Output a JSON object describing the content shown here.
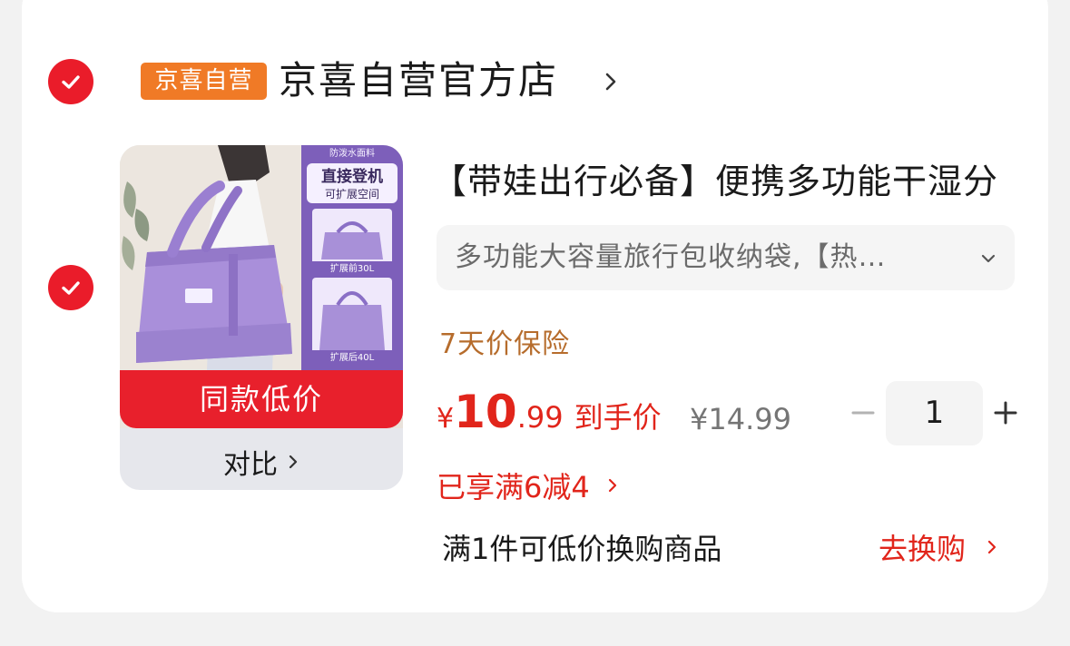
{
  "shop": {
    "badge": "京喜自营",
    "name": "京喜自营官方店"
  },
  "product": {
    "title": "【带娃出行必备】便携多功能干湿分",
    "spec": "多功能大容量旅行包收纳袋,【热…",
    "insurance": "7天价保险",
    "price_currency": "¥",
    "price_integer": "10",
    "price_decimal": ".99",
    "price_label": "到手价",
    "original_price": "¥14.99",
    "quantity": "1",
    "promo": "已享满6减4",
    "exchange_text": "满1件可低价换购商品",
    "exchange_link": "去换购",
    "thumb_banner": "同款低价",
    "compare_label": "对比",
    "thumb_labels": {
      "top": "防泼水面料",
      "headline": "直接登机",
      "sub": "可扩展空间",
      "size1": "扩展前30L",
      "size2": "扩展后40L"
    }
  },
  "colors": {
    "accent_red": "#e1251b",
    "badge_orange": "#f07a26",
    "insurance_brown": "#b66c2c",
    "product_purple": "#9b7fd0"
  }
}
